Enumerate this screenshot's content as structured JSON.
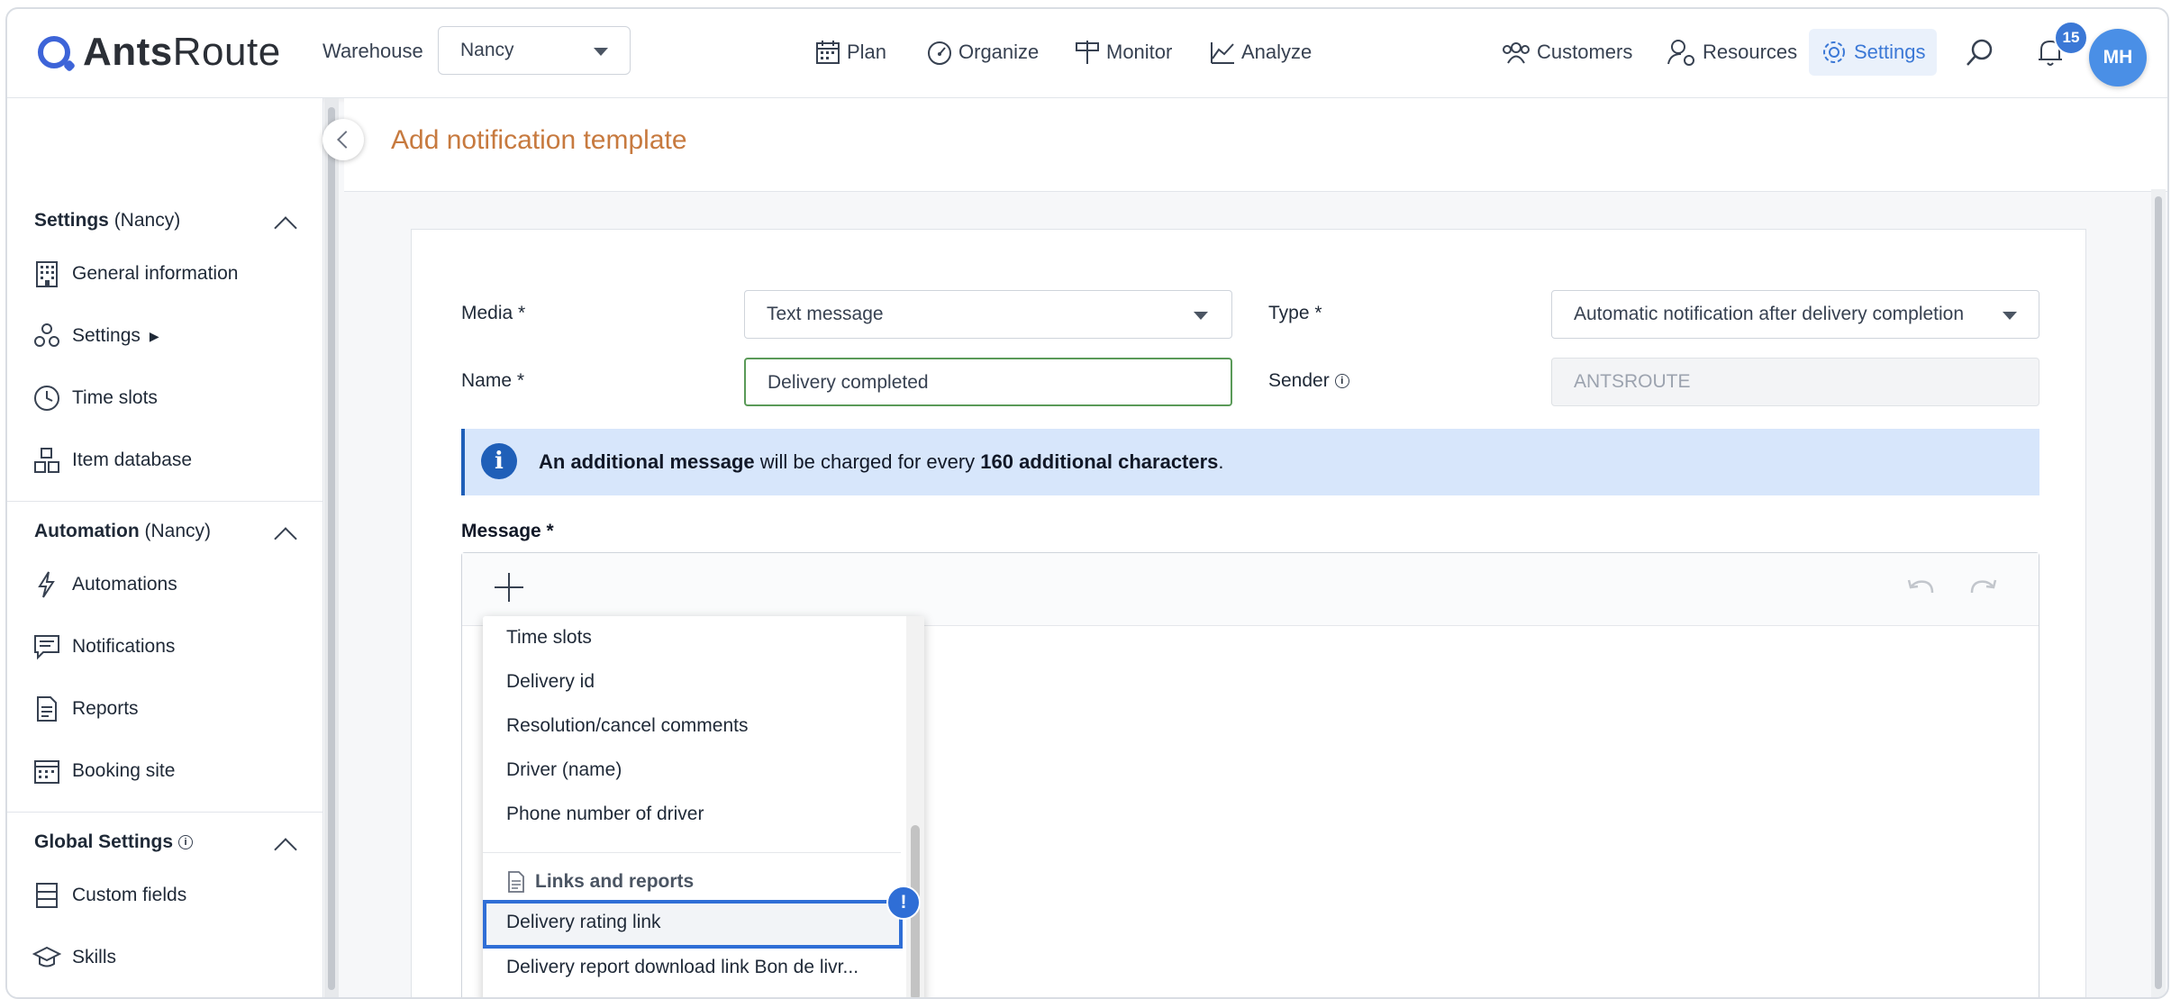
{
  "app": {
    "brand_bold": "Ants",
    "brand_light": "Route"
  },
  "header": {
    "warehouse_label": "Warehouse",
    "warehouse_value": "Nancy",
    "nav": {
      "plan": "Plan",
      "organize": "Organize",
      "monitor": "Monitor",
      "analyze": "Analyze"
    },
    "right": {
      "customers": "Customers",
      "resources": "Resources",
      "settings": "Settings"
    },
    "notification_count": "15",
    "avatar_initials": "MH",
    "accent_color": "#3b78d6"
  },
  "sidebar": {
    "settings_section": {
      "title": "Settings",
      "scope": "(Nancy)"
    },
    "settings_items": [
      "General information",
      "Settings",
      "Time slots",
      "Item database"
    ],
    "automation_section": {
      "title": "Automation",
      "scope": "(Nancy)"
    },
    "automation_items": [
      "Automations",
      "Notifications",
      "Reports",
      "Booking site"
    ],
    "global_section": {
      "title": "Global Settings"
    },
    "global_items": [
      "Custom fields",
      "Skills"
    ],
    "submenu_arrow": "▶"
  },
  "page": {
    "title": "Add notification template",
    "title_color": "#c77a3f"
  },
  "form": {
    "media_label": "Media *",
    "media_value": "Text message",
    "type_label": "Type *",
    "type_value": "Automatic notification after delivery completion",
    "name_label": "Name *",
    "name_value": "Delivery completed",
    "sender_label": "Sender",
    "sender_value": "ANTSROUTE",
    "message_label": "Message *"
  },
  "banner": {
    "bold1": "An additional message",
    "text1": " will be charged for every ",
    "bold2": "160 additional characters",
    "text2": "."
  },
  "dropdown": {
    "items": [
      "Time slots",
      "Delivery id",
      "Resolution/cancel comments",
      "Driver (name)",
      "Phone number of driver"
    ],
    "group_label": "Links and reports",
    "group_items": [
      "Delivery rating link",
      "Delivery report download link Bon de livr..."
    ],
    "alert_symbol": "!"
  }
}
